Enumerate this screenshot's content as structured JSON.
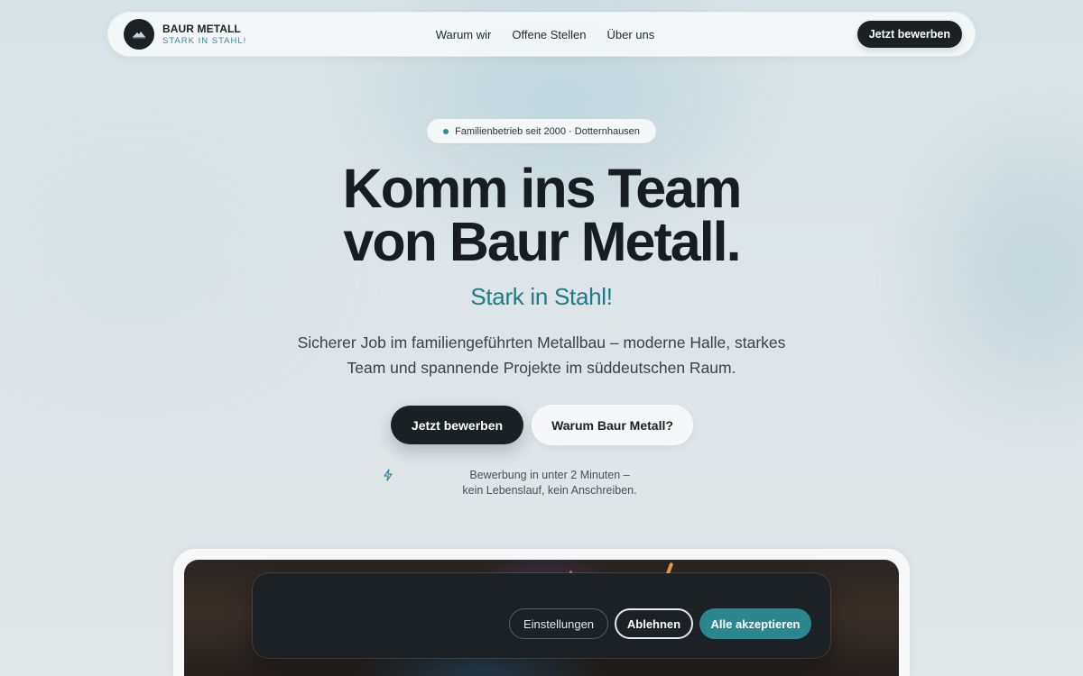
{
  "brand": {
    "name": "BAUR METALL",
    "tagline": "STARK IN STAHL!"
  },
  "nav": {
    "links": [
      "Warum wir",
      "Offene Stellen",
      "Über uns"
    ],
    "cta": "Jetzt bewerben"
  },
  "hero": {
    "badge": "Familienbetrieb seit 2000 · Dotternhausen",
    "headline_line1": "Komm ins Team",
    "headline_line2": "von Baur Metall.",
    "subheadline": "Stark in Stahl!",
    "lead_line1": "Sicherer Job im familiengeführten Metallbau – moderne Halle, starkes",
    "lead_line2": "Team und spannende Projekte im süddeutschen Raum.",
    "primary_button": "Jetzt bewerben",
    "secondary_button": "Warum Baur Metall?",
    "note_line1": "Bewerbung in unter 2 Minuten –",
    "note_line2": "kein Lebenslauf, kein Anschreiben."
  },
  "cookie_banner": {
    "settings_button": "Einstellungen",
    "reject_button": "Ablehnen",
    "accept_button": "Alle akzeptieren"
  },
  "colors": {
    "accent": "#2f8a93",
    "dark": "#1b2024"
  },
  "icons": {
    "note": "lightning-icon",
    "logo": "mountain-logo-icon"
  }
}
